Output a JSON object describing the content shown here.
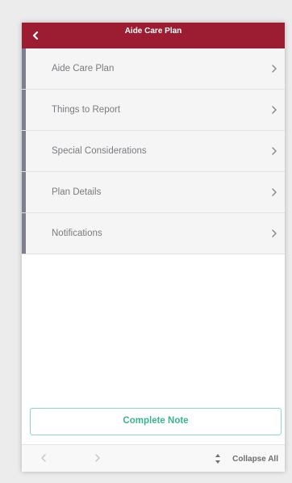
{
  "header": {
    "title": "Aide Care Plan",
    "back_icon": "chevron-left-icon",
    "color": "#9c1c32"
  },
  "menu": {
    "items": [
      {
        "label": "Aide Care Plan",
        "icon": "chevron-right-icon"
      },
      {
        "label": "Things to Report",
        "icon": "chevron-right-icon"
      },
      {
        "label": "Special Considerations",
        "icon": "chevron-right-icon"
      },
      {
        "label": "Plan Details",
        "icon": "chevron-right-icon"
      },
      {
        "label": "Notifications",
        "icon": "chevron-right-icon"
      }
    ]
  },
  "actions": {
    "complete_note_label": "Complete Note",
    "accent": "#39b58c"
  },
  "footer": {
    "prev_icon": "chevron-left-icon",
    "next_icon": "chevron-right-icon",
    "collapse_icon": "collapse-arrows-icon",
    "collapse_label": "Collapse All"
  }
}
